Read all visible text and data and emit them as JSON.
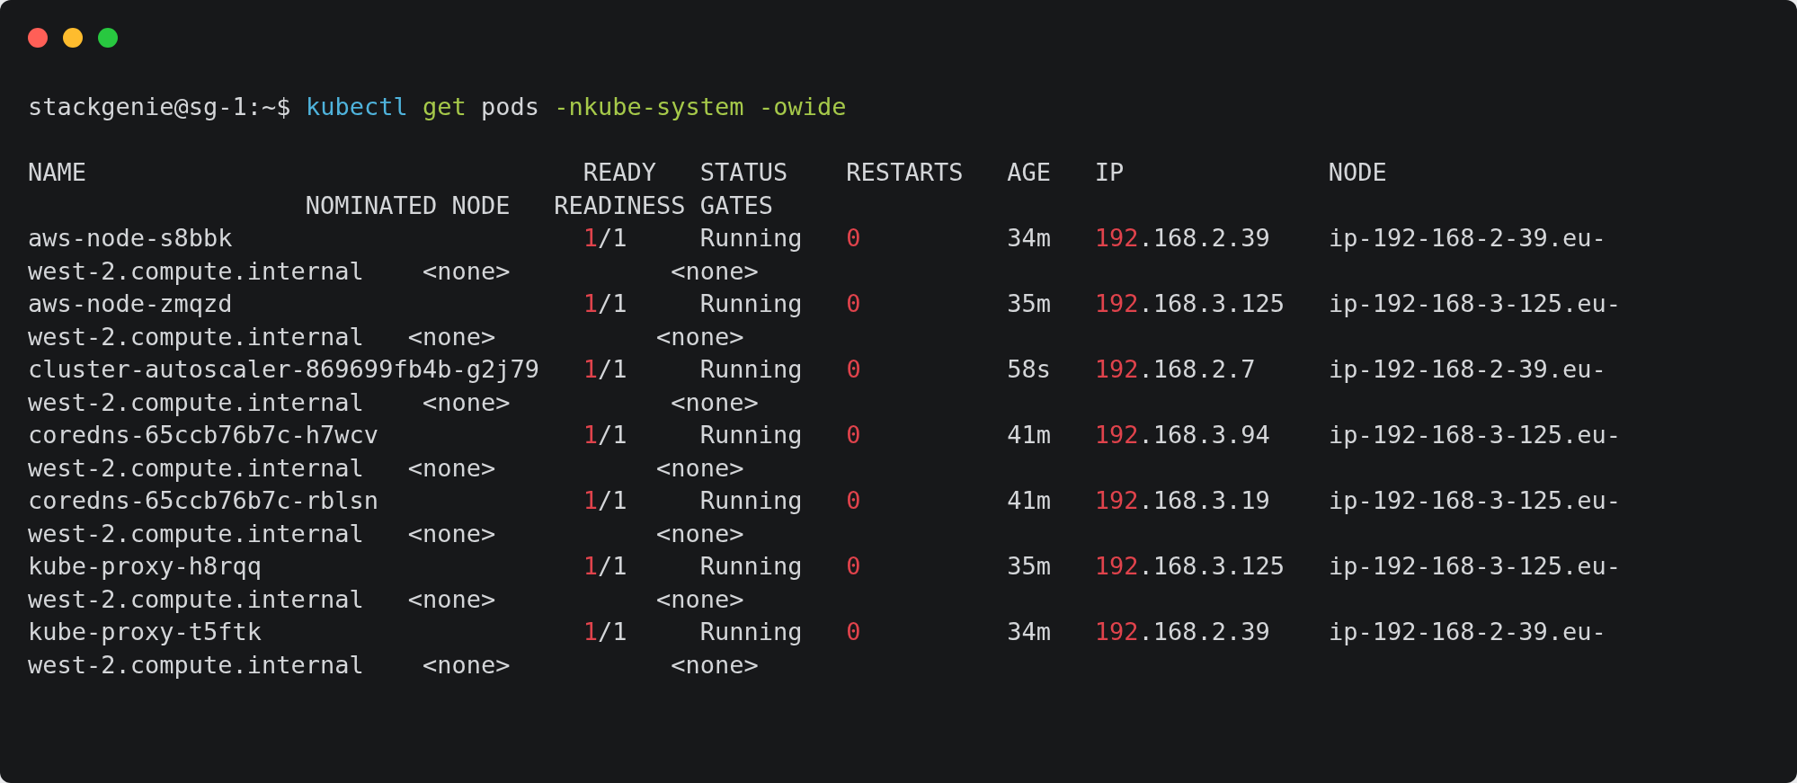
{
  "prompt": {
    "user_host": "stackgenie@sg-1:~$",
    "command": "kubectl",
    "verb": "get",
    "resource": "pods",
    "flags": [
      "-nkube-system",
      "-owide"
    ]
  },
  "header": {
    "columns": [
      "NAME",
      "READY",
      "STATUS",
      "RESTARTS",
      "AGE",
      "IP",
      "NODE"
    ],
    "wrapped_columns": [
      "NOMINATED NODE",
      "READINESS GATES"
    ]
  },
  "pods": [
    {
      "name": "aws-node-s8bbk",
      "ready_count": "1",
      "ready_total": "/1",
      "status": "Running",
      "restarts": "0",
      "age": "34m",
      "ip_prefix": "192",
      "ip_rest": ".168.2.39",
      "node_head": "ip-192-168-2-39.eu-",
      "node_tail": "west-2.compute.internal",
      "nominated_node": "<none>",
      "readiness_gates": "<none>"
    },
    {
      "name": "aws-node-zmqzd",
      "ready_count": "1",
      "ready_total": "/1",
      "status": "Running",
      "restarts": "0",
      "age": "35m",
      "ip_prefix": "192",
      "ip_rest": ".168.3.125",
      "node_head": "ip-192-168-3-125.eu-",
      "node_tail": "west-2.compute.internal",
      "nominated_node": "<none>",
      "readiness_gates": "<none>"
    },
    {
      "name": "cluster-autoscaler-869699fb4b-g2j79",
      "ready_count": "1",
      "ready_total": "/1",
      "status": "Running",
      "restarts": "0",
      "age": "58s",
      "ip_prefix": "192",
      "ip_rest": ".168.2.7",
      "node_head": "ip-192-168-2-39.eu-",
      "node_tail": "west-2.compute.internal",
      "nominated_node": "<none>",
      "readiness_gates": "<none>"
    },
    {
      "name": "coredns-65ccb76b7c-h7wcv",
      "ready_count": "1",
      "ready_total": "/1",
      "status": "Running",
      "restarts": "0",
      "age": "41m",
      "ip_prefix": "192",
      "ip_rest": ".168.3.94",
      "node_head": "ip-192-168-3-125.eu-",
      "node_tail": "west-2.compute.internal",
      "nominated_node": "<none>",
      "readiness_gates": "<none>"
    },
    {
      "name": "coredns-65ccb76b7c-rblsn",
      "ready_count": "1",
      "ready_total": "/1",
      "status": "Running",
      "restarts": "0",
      "age": "41m",
      "ip_prefix": "192",
      "ip_rest": ".168.3.19",
      "node_head": "ip-192-168-3-125.eu-",
      "node_tail": "west-2.compute.internal",
      "nominated_node": "<none>",
      "readiness_gates": "<none>"
    },
    {
      "name": "kube-proxy-h8rqq",
      "ready_count": "1",
      "ready_total": "/1",
      "status": "Running",
      "restarts": "0",
      "age": "35m",
      "ip_prefix": "192",
      "ip_rest": ".168.3.125",
      "node_head": "ip-192-168-3-125.eu-",
      "node_tail": "west-2.compute.internal",
      "nominated_node": "<none>",
      "readiness_gates": "<none>"
    },
    {
      "name": "kube-proxy-t5ftk",
      "ready_count": "1",
      "ready_total": "/1",
      "status": "Running",
      "restarts": "0",
      "age": "34m",
      "ip_prefix": "192",
      "ip_rest": ".168.2.39",
      "node_head": "ip-192-168-2-39.eu-",
      "node_tail": "west-2.compute.internal",
      "nominated_node": "<none>",
      "readiness_gates": "<none>"
    }
  ]
}
